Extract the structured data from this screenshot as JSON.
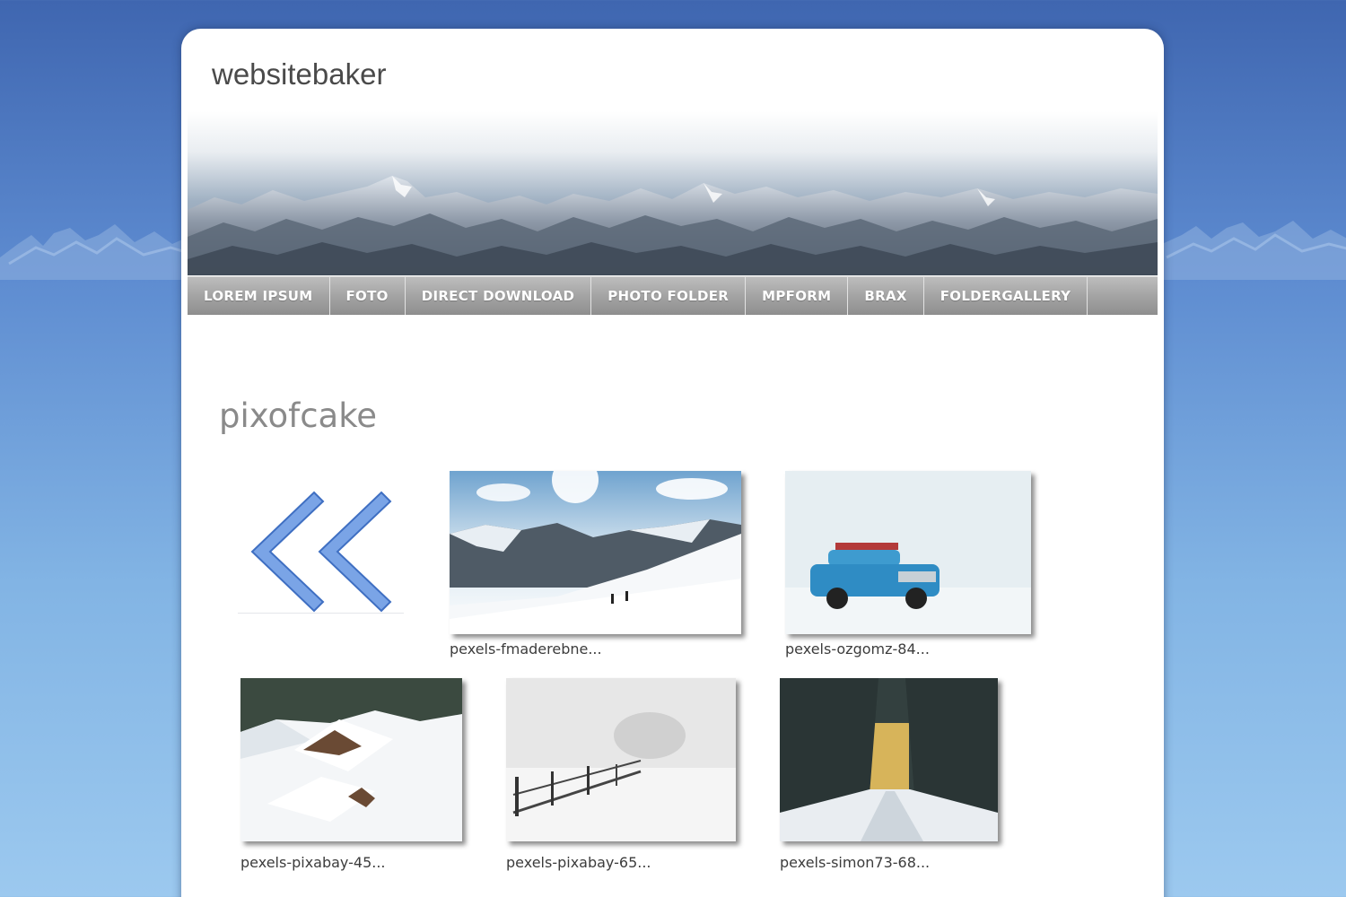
{
  "site": {
    "title": "websitebaker"
  },
  "nav": {
    "items": [
      {
        "label": "LOREM IPSUM"
      },
      {
        "label": "FOTO"
      },
      {
        "label": "DIRECT DOWNLOAD"
      },
      {
        "label": "PHOTO FOLDER"
      },
      {
        "label": "MPFORM"
      },
      {
        "label": "BRAX"
      },
      {
        "label": "FOLDERGALLERY"
      }
    ]
  },
  "main": {
    "heading": "pixofcake",
    "gallery": {
      "items": [
        {
          "caption": "pexels-fmaderebne..."
        },
        {
          "caption": "pexels-ozgomz-84..."
        },
        {
          "caption": "pexels-pixabay-45..."
        },
        {
          "caption": "pexels-pixabay-65..."
        },
        {
          "caption": "pexels-simon73-68..."
        }
      ]
    }
  },
  "colors": {
    "background_top": "#3f66b0",
    "background_bottom": "#9cc9ef",
    "nav_bar": "#a6a6a6",
    "back_arrow": "#6f9be0",
    "heading": "#8a8a8a"
  },
  "icons": {
    "back": "double-chevron-left-icon"
  }
}
